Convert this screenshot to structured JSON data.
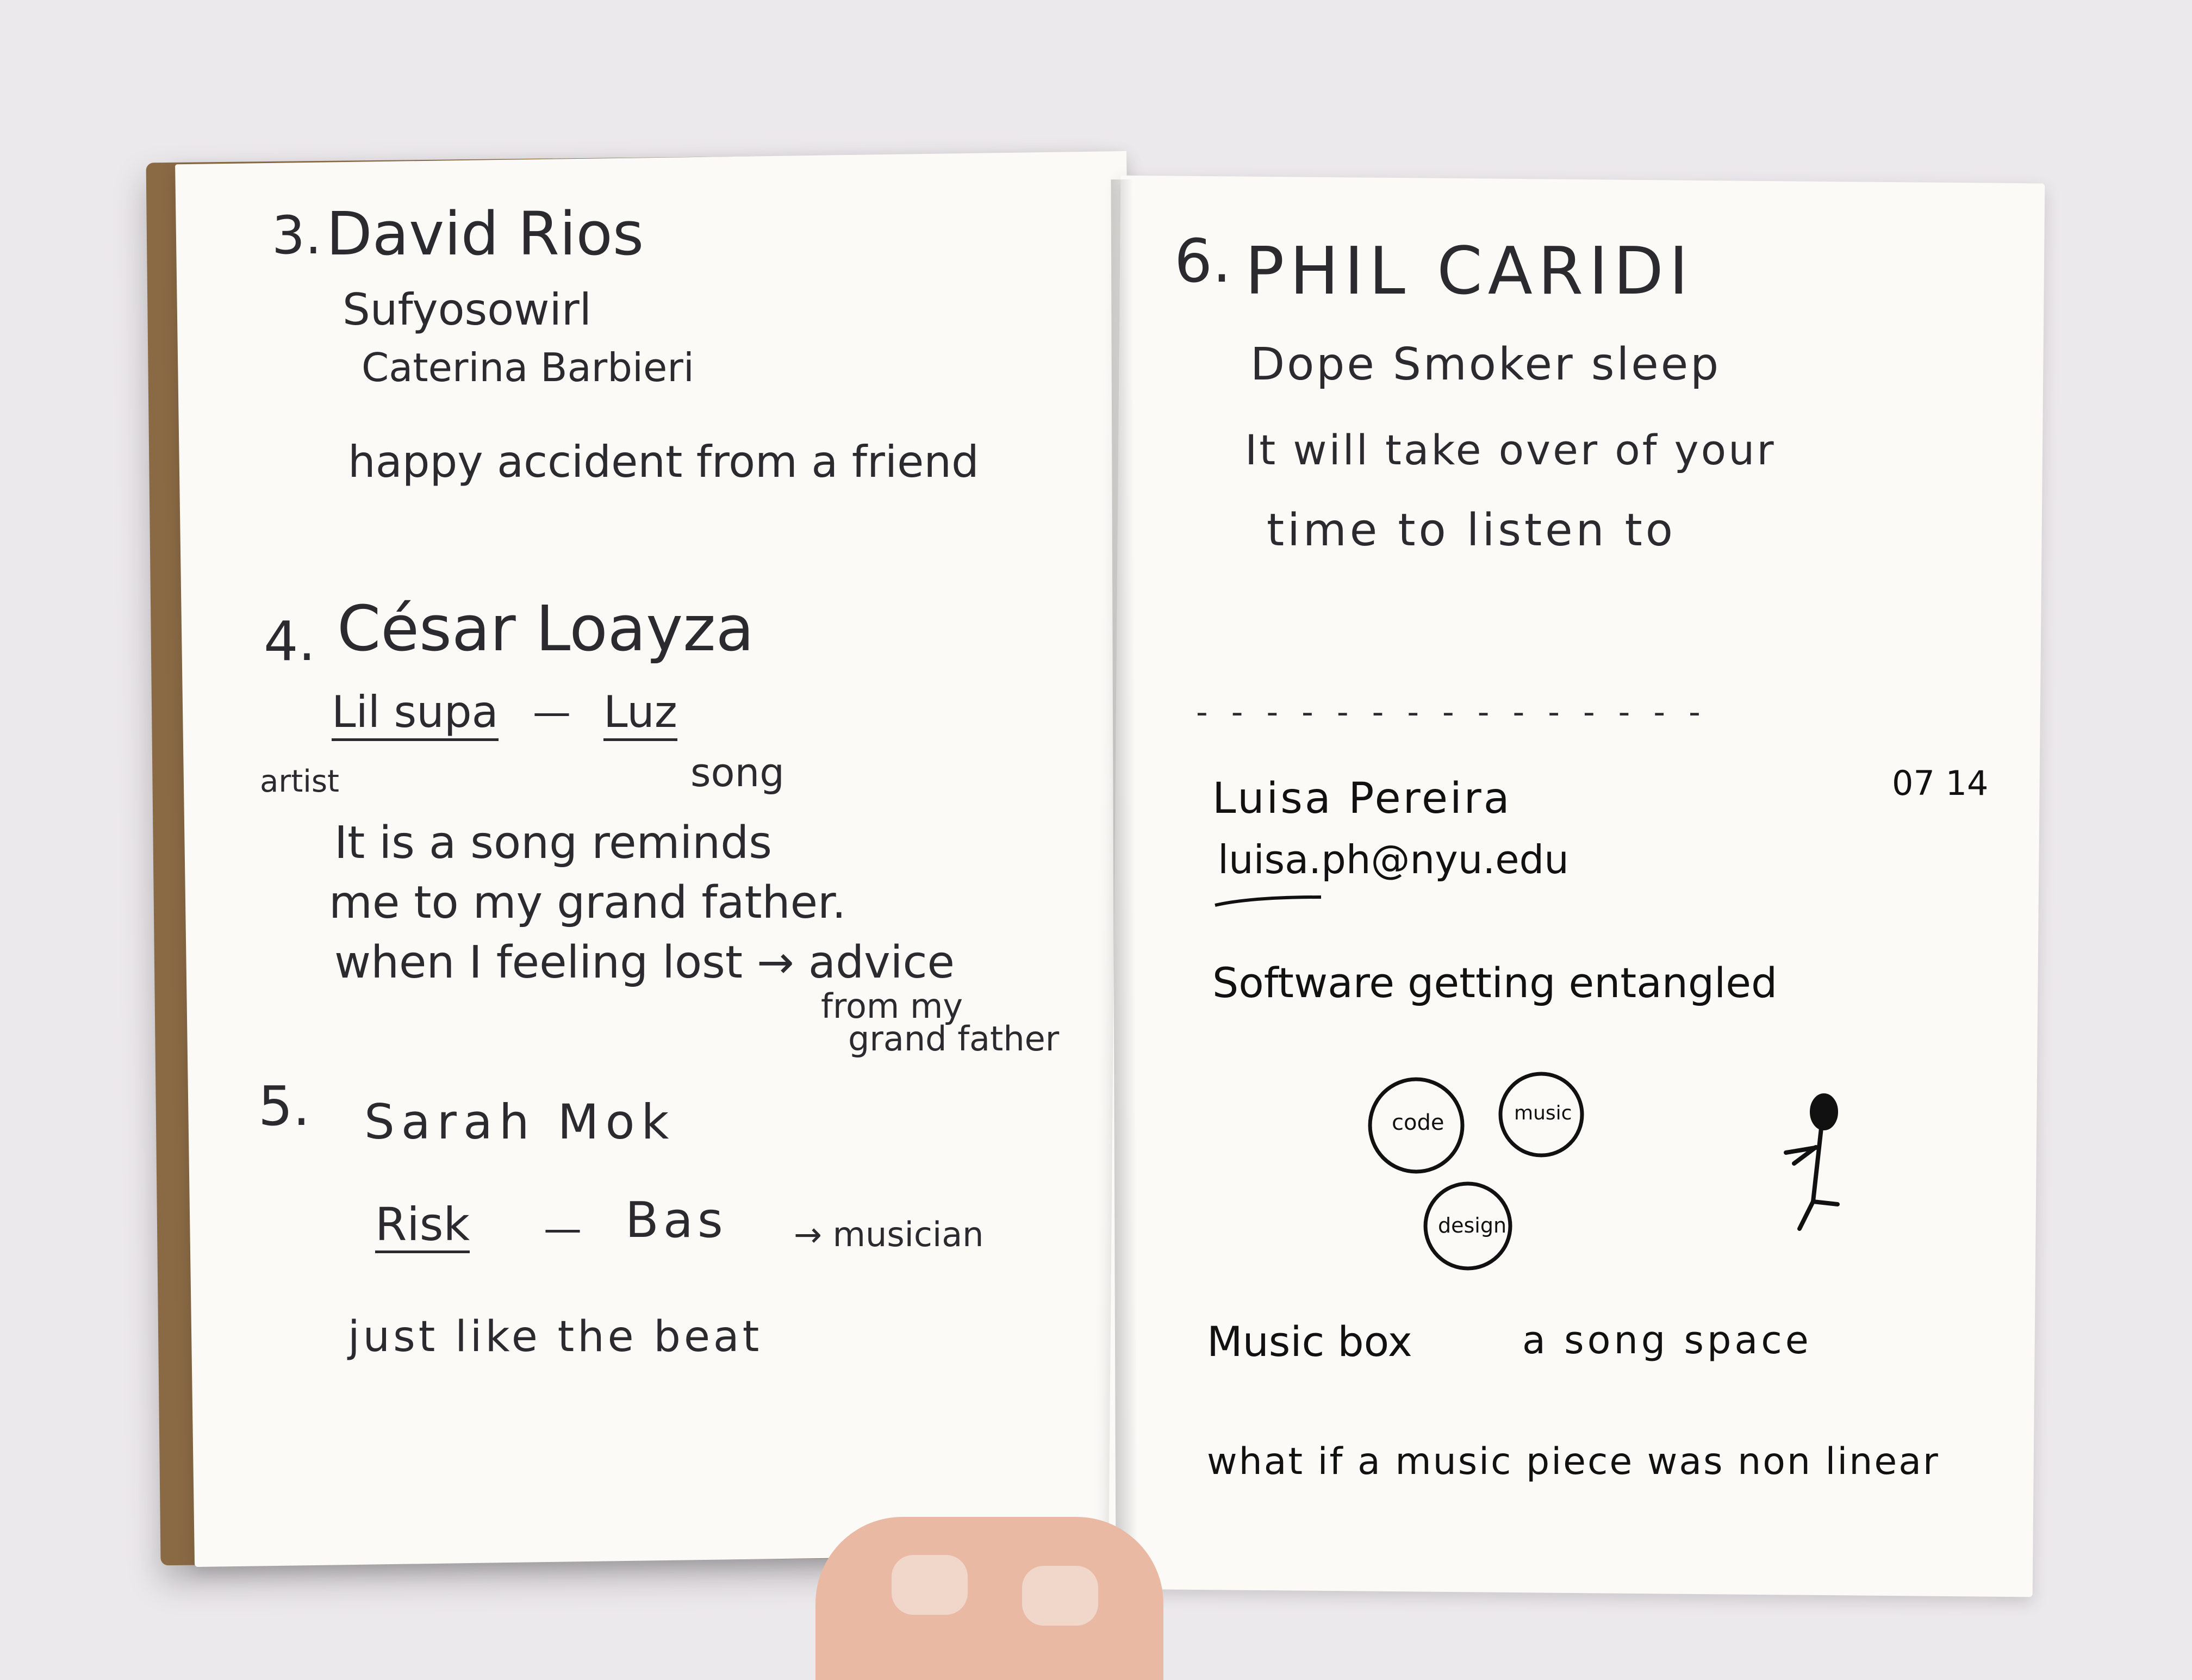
{
  "left_page": {
    "entry3": {
      "number": "3.",
      "name": "David Rios",
      "line1": "Sufyosowirl",
      "line2": "Caterina Barbieri",
      "note": "happy accident from a friend"
    },
    "entry4": {
      "number": "4.",
      "name": "César Loayza",
      "artist": "Lil supa",
      "dash": "—",
      "song": "Luz",
      "artist_label": "artist",
      "song_label": "song",
      "line1": "It is a song reminds",
      "line2": "me to my grand father.",
      "line3": "when I feeling lost → advice",
      "line4": "from my",
      "line5": "grand father"
    },
    "entry5": {
      "number": "5.",
      "name": "Sarah Mok",
      "song": "Risk",
      "dash": "—",
      "artist": "Bas",
      "artist_label": "→ musician",
      "note": "just like the beat"
    }
  },
  "right_page": {
    "entry6": {
      "number": "6.",
      "name": "PHIL CARIDI",
      "line1": "Dope Smoker sleep",
      "line2": "It will take over of your",
      "line3": "time to listen to"
    },
    "divider": "- - - - - - - - - - - - - - -",
    "contact": {
      "name": "Luisa Pereira",
      "email": "luisa.ph@nyu.edu",
      "date": "07 14"
    },
    "note1": "Software getting entangled",
    "circles": [
      "code",
      "music",
      "design"
    ],
    "note2_a": "Music box",
    "note2_b": "a song space",
    "note3": "what if a music piece was non linear"
  },
  "colors": {
    "background": "#ece9ec",
    "paper": "#fbfaf7",
    "ink": "#2b2a2e",
    "cover": "#8a6a45"
  }
}
